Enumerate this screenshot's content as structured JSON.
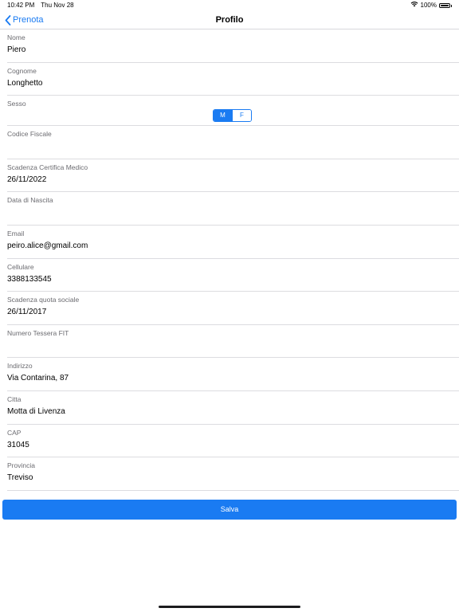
{
  "status_bar": {
    "time": "10:42 PM",
    "date": "Thu Nov 28",
    "battery": "100%"
  },
  "nav": {
    "back_label": "Prenota",
    "title": "Profilo"
  },
  "form": {
    "nome": {
      "label": "Nome",
      "value": "Piero"
    },
    "cognome": {
      "label": "Cognome",
      "value": "Longhetto"
    },
    "sesso": {
      "label": "Sesso",
      "options": [
        "M",
        "F"
      ],
      "selected": "M"
    },
    "codice_fiscale": {
      "label": "Codice Fiscale",
      "value": ""
    },
    "scadenza_certifica": {
      "label": "Scadenza Certifica Medico",
      "value": "26/11/2022"
    },
    "data_nascita": {
      "label": "Data di Nascita",
      "value": ""
    },
    "email": {
      "label": "Email",
      "value": "peiro.alice@gmail.com"
    },
    "cellulare": {
      "label": "Cellulare",
      "value": "3388133545"
    },
    "scadenza_quota": {
      "label": "Scadenza quota sociale",
      "value": "26/11/2017"
    },
    "numero_tessera": {
      "label": "Numero Tessera FIT",
      "value": ""
    },
    "indirizzo": {
      "label": "Indirizzo",
      "value": "Via Contarina, 87"
    },
    "citta": {
      "label": "Citta",
      "value": "Motta di Livenza"
    },
    "cap": {
      "label": "CAP",
      "value": "31045"
    },
    "provincia": {
      "label": "Provincia",
      "value": "Treviso"
    }
  },
  "save_label": "Salva",
  "colors": {
    "accent": "#1a7bf2",
    "label": "#6b6b70",
    "separator": "#dcdce0"
  }
}
